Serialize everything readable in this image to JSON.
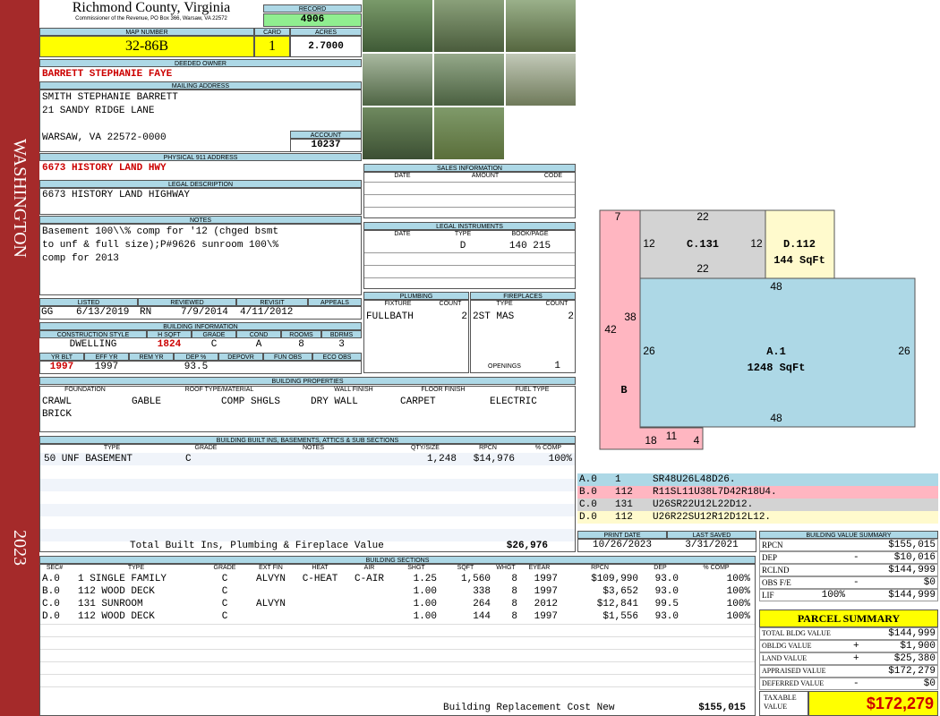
{
  "side": {
    "top": "WASHINGTON",
    "bottom": "2023"
  },
  "header": {
    "county": "Richmond County, Virginia",
    "commissioner": "Commissioner of the Revenue, PO Box 366, Warsaw, VA 22572",
    "record_label": "RECORD",
    "record": "4906",
    "map_label": "MAP NUMBER",
    "map": "32-86B",
    "card_label": "CARD",
    "card": "1",
    "acres_label": "ACRES",
    "acres": "2.7000"
  },
  "owner": {
    "deeded_label": "DEEDED OWNER",
    "deeded": "BARRETT STEPHANIE FAYE",
    "mailing_label": "MAILING ADDRESS",
    "line1": "SMITH STEPHANIE BARRETT",
    "line2": "21 SANDY RIDGE LANE",
    "line3": "WARSAW, VA 22572-0000",
    "account_label": "ACCOUNT",
    "account": "10237",
    "phys_label": "PHYSICAL 911 ADDRESS",
    "phys": "6673 HISTORY LAND HWY",
    "legal_label": "LEGAL DESCRIPTION",
    "legal": "6673 HISTORY LAND HIGHWAY",
    "notes_label": "NOTES",
    "notes": [
      "Basement 100\\\\% comp for '12 (chged bsmt",
      "to unf & full size);P#9626 sunroom 100\\%",
      "comp for 2013"
    ]
  },
  "dates": {
    "listed_label": "LISTED",
    "reviewed_label": "REVIEWED",
    "revisit_label": "REVISIT",
    "appeals_label": "APPEALS",
    "listed_by": "GG",
    "listed": "6/13/2019",
    "reviewed_by": "RN",
    "reviewed": "7/9/2014",
    "revisit": "4/11/2012"
  },
  "building": {
    "label": "BUILDING INFORMATION",
    "h": [
      "CONSTRUCTION STYLE",
      "H SQFT",
      "GRADE",
      "COND",
      "ROOMS",
      "BDRMS"
    ],
    "v": [
      "DWELLING",
      "1824",
      "C",
      "A",
      "8",
      "3"
    ],
    "h2": [
      "YR BLT",
      "EFF YR",
      "REM YR",
      "DEP %",
      "DEPOVR",
      "FUN OBS",
      "ECO OBS"
    ],
    "v2": [
      "1997",
      "1997",
      "",
      "93.5",
      "",
      "",
      ""
    ]
  },
  "sales": {
    "label": "SALES INFORMATION",
    "h": [
      "DATE",
      "AMOUNT",
      "CODE"
    ]
  },
  "legal_inst": {
    "label": "LEGAL INSTRUMENTS",
    "h": [
      "DATE",
      "TYPE",
      "BOOK/PAGE"
    ],
    "type": "D",
    "book": "140 215"
  },
  "plumbing": {
    "label": "PLUMBING",
    "h": [
      "FIXTURE",
      "COUNT"
    ],
    "fixture": "FULLBATH",
    "count": "2"
  },
  "fireplaces": {
    "label": "FIREPLACES",
    "h": [
      "TYPE",
      "COUNT"
    ],
    "type": "2ST MAS",
    "count": "2",
    "openings_label": "OPENINGS",
    "openings": "1"
  },
  "props": {
    "label": "BUILDING PROPERTIES",
    "h": [
      "FOUNDATION",
      "ROOF TYPE/MATERIAL",
      "WALL FINISH",
      "FLOOR FINISH",
      "FUEL TYPE"
    ],
    "foundation1": "CRAWL",
    "foundation2": "BRICK",
    "roof1": "GABLE",
    "roof2": "COMP SHGLS",
    "wall": "DRY WALL",
    "floor": "CARPET",
    "fuel": "ELECTRIC"
  },
  "builtins": {
    "label": "BUILDING BUILT INS, BASEMENTS, ATTICS & SUB SECTIONS",
    "h": [
      "TYPE",
      "GRADE",
      "NOTES",
      "QTY/SIZE",
      "RPCN",
      "% COMP"
    ],
    "row": [
      "50 UNF BASEMENT",
      "C",
      "",
      "1,248",
      "$14,976",
      "100%"
    ],
    "total_label": "Total Built Ins, Plumbing & Fireplace Value",
    "total": "$26,976"
  },
  "print": {
    "print_label": "PRINT DATE",
    "saved_label": "LAST SAVED",
    "print": "10/26/2023",
    "saved": "3/31/2021"
  },
  "sections": {
    "label": "BUILDING SECTIONS",
    "h": [
      "SEC#",
      "TYPE",
      "GRADE",
      "EXT FIN",
      "HEAT",
      "AIR",
      "SHGT",
      "SQFT",
      "WHGT",
      "EYEAR",
      "RPCN",
      "DEP",
      "% COMP"
    ],
    "rows": [
      [
        "A.0",
        "1 SINGLE FAMILY",
        "C",
        "ALVYN",
        "C-HEAT",
        "C-AIR",
        "1.25",
        "1,560",
        "8",
        "1997",
        "$109,990",
        "93.0",
        "100%"
      ],
      [
        "B.0",
        "112 WOOD DECK",
        "C",
        "",
        "",
        "",
        "1.00",
        "338",
        "8",
        "1997",
        "$3,652",
        "93.0",
        "100%"
      ],
      [
        "C.0",
        "131 SUNROOM",
        "C",
        "ALVYN",
        "",
        "",
        "1.00",
        "264",
        "8",
        "2012",
        "$12,841",
        "99.5",
        "100%"
      ],
      [
        "D.0",
        "112 WOOD DECK",
        "C",
        "",
        "",
        "",
        "1.00",
        "144",
        "8",
        "1997",
        "$1,556",
        "93.0",
        "100%"
      ]
    ],
    "total_label": "Building Replacement Cost New",
    "total": "$155,015"
  },
  "sketch": {
    "labels": [
      "7",
      "22",
      "12",
      "C.131",
      "12",
      "D.112",
      "144 SqFt",
      "22",
      "48",
      "42",
      "38",
      "26",
      "A.1",
      "1248 SqFt",
      "26",
      "B",
      "48",
      "18",
      "11",
      "4"
    ],
    "legend": [
      {
        "id": "A.0",
        "code": "1",
        "path": "SR48U26L48D26.",
        "color": "#add8e6"
      },
      {
        "id": "B.0",
        "code": "112",
        "path": "R11SL11U38L7D42R18U4.",
        "color": "#ffb6c1"
      },
      {
        "id": "C.0",
        "code": "131",
        "path": "U26SR22U12L22D12.",
        "color": "#d3d3d3"
      },
      {
        "id": "D.0",
        "code": "112",
        "path": "U26R22SU12R12D12L12.",
        "color": "#fffacd"
      }
    ]
  },
  "bvs": {
    "label": "BUILDING VALUE SUMMARY",
    "rows": [
      {
        "k": "RPCN",
        "op": "",
        "v": "$155,015"
      },
      {
        "k": "DEP",
        "op": "-",
        "v": "$10,016"
      },
      {
        "k": "RCLND",
        "op": "",
        "v": "$144,999"
      },
      {
        "k": "OBS F/E",
        "op": "-",
        "v": "$0"
      },
      {
        "k": "LIF",
        "pct": "100%",
        "op": "",
        "v": "$144,999"
      }
    ]
  },
  "parcel": {
    "label": "PARCEL SUMMARY",
    "rows": [
      {
        "k": "TOTAL BLDG VALUE",
        "op": "",
        "v": "$144,999"
      },
      {
        "k": "OBLDG VALUE",
        "op": "+",
        "v": "$1,900"
      },
      {
        "k": "LAND VALUE",
        "op": "+",
        "v": "$25,380"
      },
      {
        "k": "APPRAISED VALUE",
        "op": "",
        "v": "$172,279"
      },
      {
        "k": "DEFERRED VALUE",
        "op": "-",
        "v": "$0"
      }
    ],
    "taxable_label1": "TAXABLE",
    "taxable_label2": "VALUE",
    "taxable": "$172,279"
  },
  "colors": {
    "side": "#a52a2a",
    "header": "#add8e6",
    "yellow": "#ffff00",
    "record": "#90ee90",
    "red": "#cc0000"
  }
}
